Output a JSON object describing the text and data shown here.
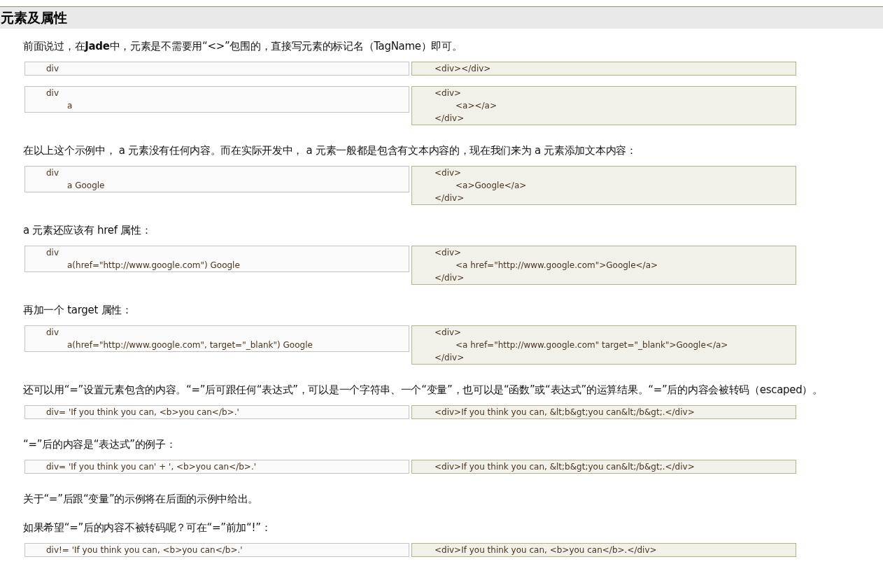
{
  "section_title": "元素及属性",
  "content": [
    {
      "kind": "paragraph",
      "text": "前面说过，在**Jade**中，元素是不需要用“<>”包围的，直接写元素的标记名（TagName）即可。"
    },
    {
      "kind": "code",
      "jade": [
        {
          "text": "div"
        }
      ],
      "html": [
        {
          "text": "<div></div>"
        }
      ]
    },
    {
      "kind": "code",
      "jade": [
        {
          "text": "div",
          "children": [
            {
              "text": "a"
            }
          ]
        }
      ],
      "html": [
        {
          "text": "<div>",
          "children": [
            {
              "text": "<a></a>"
            }
          ]
        },
        {
          "text": "</div>"
        }
      ]
    },
    {
      "kind": "paragraph",
      "text": "在以上这个示例中， a 元素没有任何内容。而在实际开发中， a 元素一般都是包含有文本内容的，现在我们来为 a 元素添加文本内容："
    },
    {
      "kind": "code",
      "jade": [
        {
          "text": "div",
          "children": [
            {
              "text": "a Google"
            }
          ]
        }
      ],
      "html": [
        {
          "text": "<div>",
          "children": [
            {
              "text": "<a>Google</a>"
            }
          ]
        },
        {
          "text": "</div>"
        }
      ]
    },
    {
      "kind": "paragraph",
      "text": "a 元素还应该有 href 属性："
    },
    {
      "kind": "code",
      "jade": [
        {
          "text": "div",
          "children": [
            {
              "text": "a(href=\"http://www.google.com\") Google"
            }
          ]
        }
      ],
      "html": [
        {
          "text": "<div>",
          "children": [
            {
              "text": "<a href=\"http://www.google.com\">Google</a>"
            }
          ]
        },
        {
          "text": "</div>"
        }
      ]
    },
    {
      "kind": "paragraph",
      "text": "再加一个 target 属性："
    },
    {
      "kind": "code",
      "jade": [
        {
          "text": "div",
          "children": [
            {
              "text": "a(href=\"http://www.google.com\", target=\"_blank\") Google"
            }
          ]
        }
      ],
      "html": [
        {
          "text": "<div>",
          "children": [
            {
              "text": "<a href=\"http://www.google.com\" target=\"_blank\">Google</a>"
            }
          ]
        },
        {
          "text": "</div>"
        }
      ]
    },
    {
      "kind": "paragraph",
      "text": "还可以用“=”设置元素包含的内容。“=”后可跟任何“表达式”，可以是一个字符串、一个“变量”，也可以是“函数”或“表达式”的运算结果。“=”后的内容会被转码（escaped）。"
    },
    {
      "kind": "code",
      "jade": [
        {
          "text": "div= 'If you think you can, <b>you can</b>.'"
        }
      ],
      "html": [
        {
          "text": "<div>If you think you can, &lt;b&gt;you can&lt;/b&gt;.</div>"
        }
      ]
    },
    {
      "kind": "paragraph",
      "text": "“=”后的内容是“表达式”的例子："
    },
    {
      "kind": "code",
      "jade": [
        {
          "text": "div= 'If you think you can' + ', <b>you can</b>.'"
        }
      ],
      "html": [
        {
          "text": "<div>If you think you can, &lt;b&gt;you can&lt;/b&gt;.</div>"
        }
      ]
    },
    {
      "kind": "paragraph",
      "text": "关于“=”后跟“变量”的示例将在后面的示例中给出。"
    },
    {
      "kind": "paragraph",
      "text": "如果希望“=”后的内容不被转码呢？可在“=”前加“!”："
    },
    {
      "kind": "code",
      "jade": [
        {
          "text": "div!= 'If you think you can, <b>you can</b>.'"
        }
      ],
      "html": [
        {
          "text": "<div>If you think you can, <b>you can</b>.</div>"
        }
      ]
    }
  ]
}
